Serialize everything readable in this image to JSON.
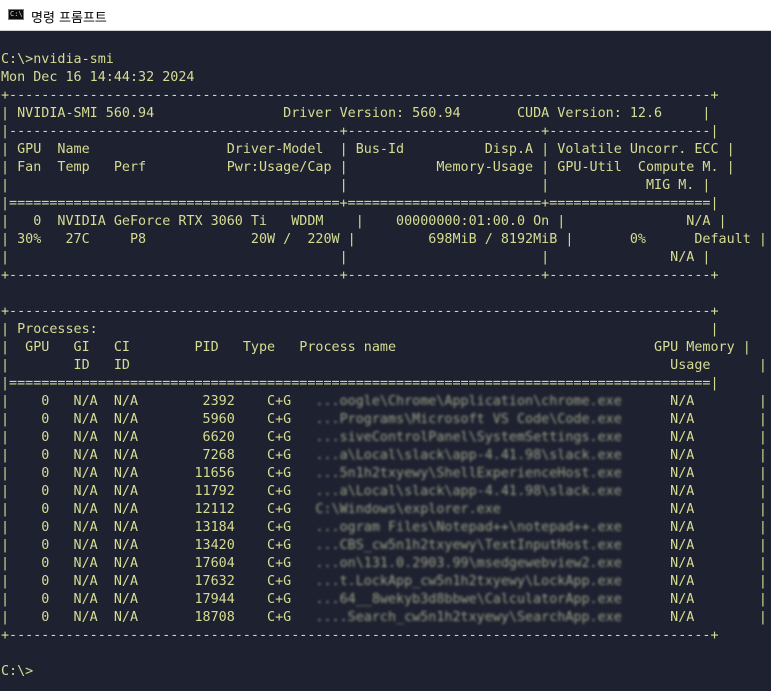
{
  "window": {
    "title": "명령 프롬프트",
    "icon": "cmd-icon",
    "icon_text": "C:\\"
  },
  "colors": {
    "background": "#1e2130",
    "text": "#d6dc92"
  },
  "command": {
    "prompt": "C:\\>",
    "text": "nvidia-smi"
  },
  "timestamp": "Mon Dec 16 14:44:32 2024",
  "smi": {
    "version_label": "NVIDIA-SMI 560.94",
    "driver_label": "Driver Version: 560.94",
    "cuda_label": "CUDA Version: 12.6"
  },
  "gpu_table": {
    "headers": {
      "c1r1": "GPU  Name                 Driver-Model",
      "c1r2": "Fan  Temp   Perf          Pwr:Usage/Cap",
      "c2r1": "Bus-Id          Disp.A",
      "c2r2": "Memory-Usage",
      "c3r1": "Volatile Uncorr. ECC",
      "c3r2": "GPU-Util  Compute M.",
      "c3r3": "MIG M."
    },
    "gpu": {
      "index": "0",
      "name": "NVIDIA GeForce RTX 3060 Ti",
      "driver_model": "WDDM",
      "fan": "30%",
      "temp": "27C",
      "perf": "P8",
      "pwr_usage": "20W",
      "pwr_cap": "220W",
      "bus_id": "00000000:01:00.0",
      "disp": "On",
      "mem_used": "698MiB",
      "mem_total": "8192MiB",
      "ecc": "N/A",
      "util": "0%",
      "compute": "Default",
      "mig": "N/A"
    }
  },
  "processes": {
    "label": "Processes:",
    "headers": {
      "gpu": "GPU",
      "gi": "GI",
      "ci": "CI",
      "pid": "PID",
      "type": "Type",
      "name": "Process name",
      "mem1": "GPU Memory",
      "id": "ID",
      "usage": "Usage"
    },
    "rows": [
      {
        "gpu": "0",
        "gi": "N/A",
        "ci": "N/A",
        "pid": "2392",
        "type": "C+G",
        "name": "...oogle\\Chrome\\Application\\chrome.exe",
        "mem": "N/A"
      },
      {
        "gpu": "0",
        "gi": "N/A",
        "ci": "N/A",
        "pid": "5960",
        "type": "C+G",
        "name": "...Programs\\Microsoft VS Code\\Code.exe",
        "mem": "N/A"
      },
      {
        "gpu": "0",
        "gi": "N/A",
        "ci": "N/A",
        "pid": "6620",
        "type": "C+G",
        "name": "...siveControlPanel\\SystemSettings.exe",
        "mem": "N/A"
      },
      {
        "gpu": "0",
        "gi": "N/A",
        "ci": "N/A",
        "pid": "7268",
        "type": "C+G",
        "name": "...a\\Local\\slack\\app-4.41.98\\slack.exe",
        "mem": "N/A"
      },
      {
        "gpu": "0",
        "gi": "N/A",
        "ci": "N/A",
        "pid": "11656",
        "type": "C+G",
        "name": "...5n1h2txyewy\\ShellExperienceHost.exe",
        "mem": "N/A"
      },
      {
        "gpu": "0",
        "gi": "N/A",
        "ci": "N/A",
        "pid": "11792",
        "type": "C+G",
        "name": "...a\\Local\\slack\\app-4.41.98\\slack.exe",
        "mem": "N/A"
      },
      {
        "gpu": "0",
        "gi": "N/A",
        "ci": "N/A",
        "pid": "12112",
        "type": "C+G",
        "name": "C:\\Windows\\explorer.exe",
        "mem": "N/A"
      },
      {
        "gpu": "0",
        "gi": "N/A",
        "ci": "N/A",
        "pid": "13184",
        "type": "C+G",
        "name": "...ogram Files\\Notepad++\\notepad++.exe",
        "mem": "N/A"
      },
      {
        "gpu": "0",
        "gi": "N/A",
        "ci": "N/A",
        "pid": "13420",
        "type": "C+G",
        "name": "...CBS_cw5n1h2txyewy\\TextInputHost.exe",
        "mem": "N/A"
      },
      {
        "gpu": "0",
        "gi": "N/A",
        "ci": "N/A",
        "pid": "17604",
        "type": "C+G",
        "name": "...on\\131.0.2903.99\\msedgewebview2.exe",
        "mem": "N/A"
      },
      {
        "gpu": "0",
        "gi": "N/A",
        "ci": "N/A",
        "pid": "17632",
        "type": "C+G",
        "name": "...t.LockApp_cw5n1h2txyewy\\LockApp.exe",
        "mem": "N/A"
      },
      {
        "gpu": "0",
        "gi": "N/A",
        "ci": "N/A",
        "pid": "17944",
        "type": "C+G",
        "name": "...64__8wekyb3d8bbwe\\CalculatorApp.exe",
        "mem": "N/A"
      },
      {
        "gpu": "0",
        "gi": "N/A",
        "ci": "N/A",
        "pid": "18708",
        "type": "C+G",
        "name": "....Search_cw5n1h2txyewy\\SearchApp.exe",
        "mem": "N/A"
      }
    ]
  },
  "final_prompt": "C:\\>"
}
